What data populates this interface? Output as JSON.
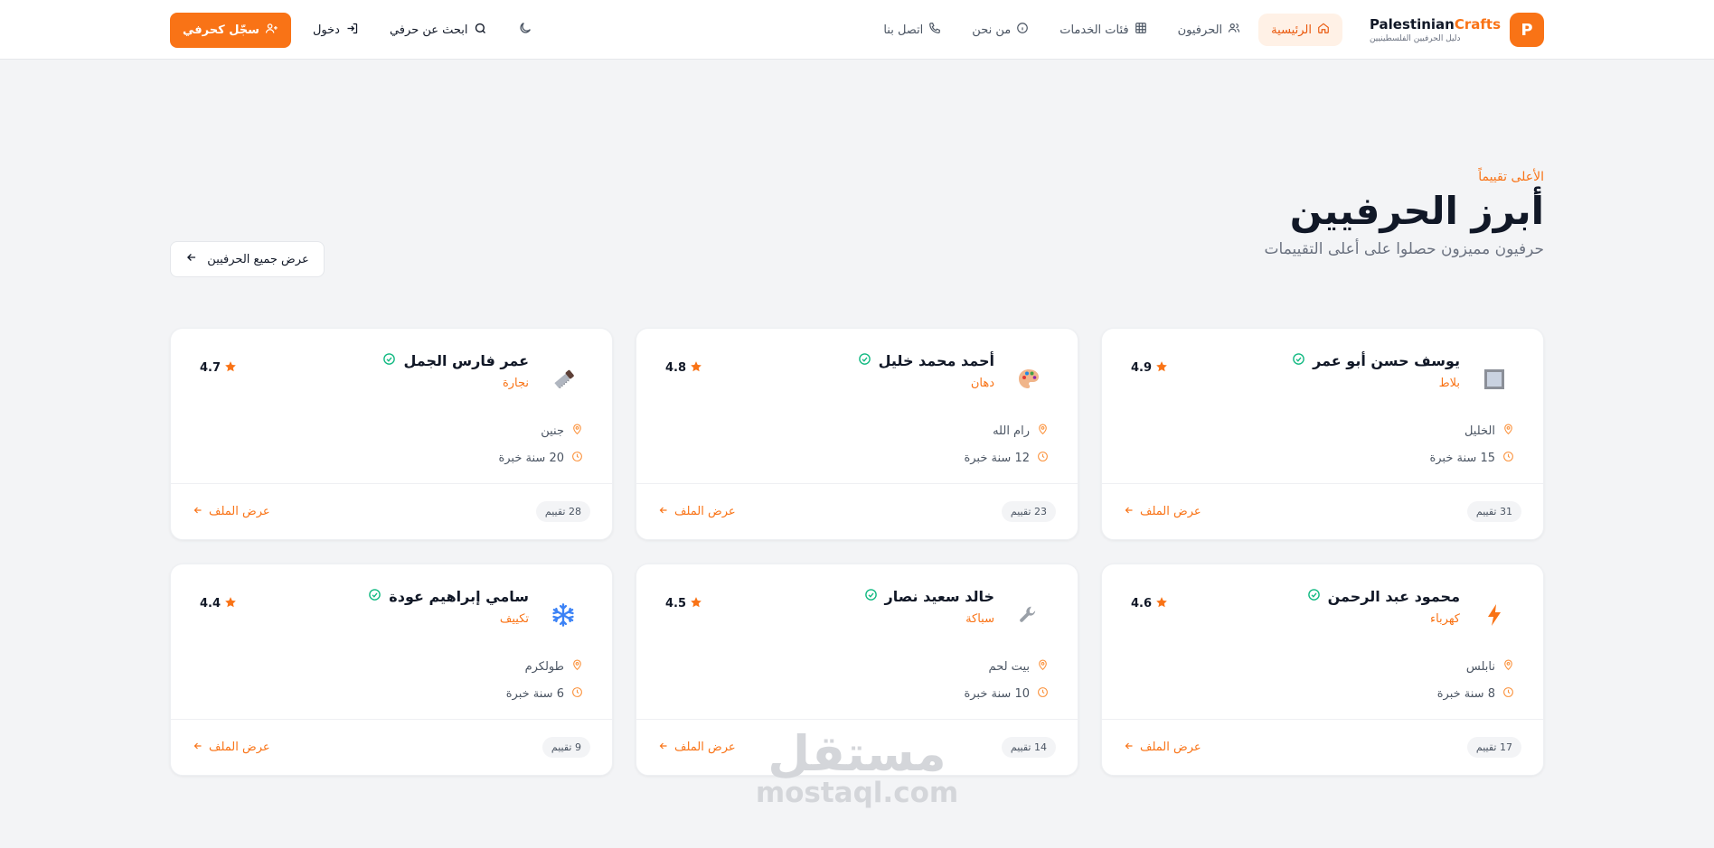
{
  "brand": {
    "name_part1": "Palestinian",
    "name_part2": "Crafts",
    "logo_letter": "P",
    "tagline": "دليل الحرفيين الفلسطينيين"
  },
  "nav": {
    "items": [
      {
        "label": "الرئيسية",
        "icon": "home-icon",
        "active": true
      },
      {
        "label": "الحرفيون",
        "icon": "users-icon",
        "active": false
      },
      {
        "label": "فئات الخدمات",
        "icon": "grid-icon",
        "active": false
      },
      {
        "label": "من نحن",
        "icon": "info-icon",
        "active": false
      },
      {
        "label": "اتصل بنا",
        "icon": "phone-icon",
        "active": false
      }
    ]
  },
  "actions": {
    "search_label": "ابحث عن حرفي",
    "login_label": "دخول",
    "register_label": "سجّل كحرفي",
    "theme_icon": "moon-icon"
  },
  "section": {
    "eyebrow": "الأعلى تقييماً",
    "title": "أبرز الحرفيين",
    "subtitle": "حرفيون مميزون حصلوا على أعلى التقييمات",
    "view_all_label": "عرض جميع الحرفيين"
  },
  "cards": [
    {
      "name": "يوسف حسن أبو عمر",
      "trade": "بلاط",
      "icon": "tile-icon",
      "rating": "4.9",
      "city": "الخليل",
      "experience": "15 سنة خبرة",
      "reviews": "31 تقييم",
      "profile_label": "عرض الملف"
    },
    {
      "name": "أحمد محمد خليل",
      "trade": "دهان",
      "icon": "palette-icon",
      "rating": "4.8",
      "city": "رام الله",
      "experience": "12 سنة خبرة",
      "reviews": "23 تقييم",
      "profile_label": "عرض الملف"
    },
    {
      "name": "عمر فارس الجمل",
      "trade": "نجارة",
      "icon": "saw-icon",
      "rating": "4.7",
      "city": "جنين",
      "experience": "20 سنة خبرة",
      "reviews": "28 تقييم",
      "profile_label": "عرض الملف"
    },
    {
      "name": "محمود عبد الرحمن",
      "trade": "كهرباء",
      "icon": "lightning-icon",
      "rating": "4.6",
      "city": "نابلس",
      "experience": "8 سنة خبرة",
      "reviews": "17 تقييم",
      "profile_label": "عرض الملف"
    },
    {
      "name": "خالد سعيد نصار",
      "trade": "سباكة",
      "icon": "wrench-icon",
      "rating": "4.5",
      "city": "بيت لحم",
      "experience": "10 سنة خبرة",
      "reviews": "14 تقييم",
      "profile_label": "عرض الملف"
    },
    {
      "name": "سامي إبراهيم عودة",
      "trade": "تكييف",
      "icon": "snowflake-icon",
      "rating": "4.4",
      "city": "طولكرم",
      "experience": "6 سنة خبرة",
      "reviews": "9 تقييم",
      "profile_label": "عرض الملف"
    }
  ],
  "watermark": {
    "arabic": "مستقل",
    "latin": "mostaql.com"
  },
  "colors": {
    "accent": "#f97316",
    "verified": "#10b981",
    "background": "#f3f4f6"
  }
}
